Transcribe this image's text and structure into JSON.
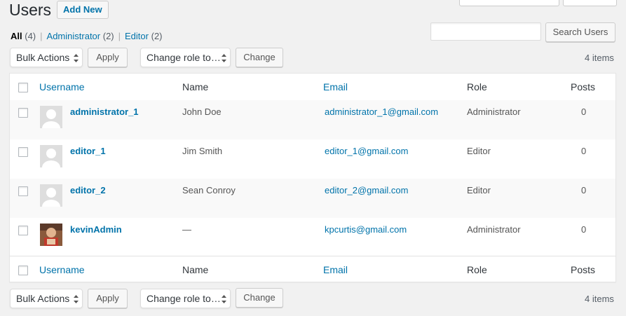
{
  "header": {
    "title": "Users",
    "add_new": "Add New"
  },
  "views": [
    {
      "label": "All",
      "count": "(4)"
    },
    {
      "label": "Administrator",
      "count": "(2)"
    },
    {
      "label": "Editor",
      "count": "(2)"
    }
  ],
  "search": {
    "button": "Search Users",
    "value": ""
  },
  "top_nav": {
    "bulk": "Bulk Actions",
    "apply": "Apply",
    "role": "Change role to…",
    "change": "Change",
    "count": "4 items"
  },
  "bottom_nav": {
    "bulk": "Bulk Actions",
    "apply": "Apply",
    "role": "Change role to…",
    "change": "Change",
    "count": "4 items"
  },
  "columns": {
    "username": "Username",
    "name": "Name",
    "email": "Email",
    "role": "Role",
    "posts": "Posts"
  },
  "users": [
    {
      "username": "administrator_1",
      "name": "John Doe",
      "email": "administrator_1@gmail.com",
      "role": "Administrator",
      "posts": "0"
    },
    {
      "username": "editor_1",
      "name": "Jim Smith",
      "email": "editor_1@gmail.com",
      "role": "Editor",
      "posts": "0"
    },
    {
      "username": "editor_2",
      "name": "Sean Conroy",
      "email": "editor_2@gmail.com",
      "role": "Editor",
      "posts": "0"
    },
    {
      "username": "kevinAdmin",
      "name": "—",
      "email": "kpcurtis@gmail.com",
      "role": "Administrator",
      "posts": "0"
    }
  ],
  "colors": {
    "link": "#0073aa",
    "text": "#32373c",
    "bg": "#f1f1f1"
  }
}
